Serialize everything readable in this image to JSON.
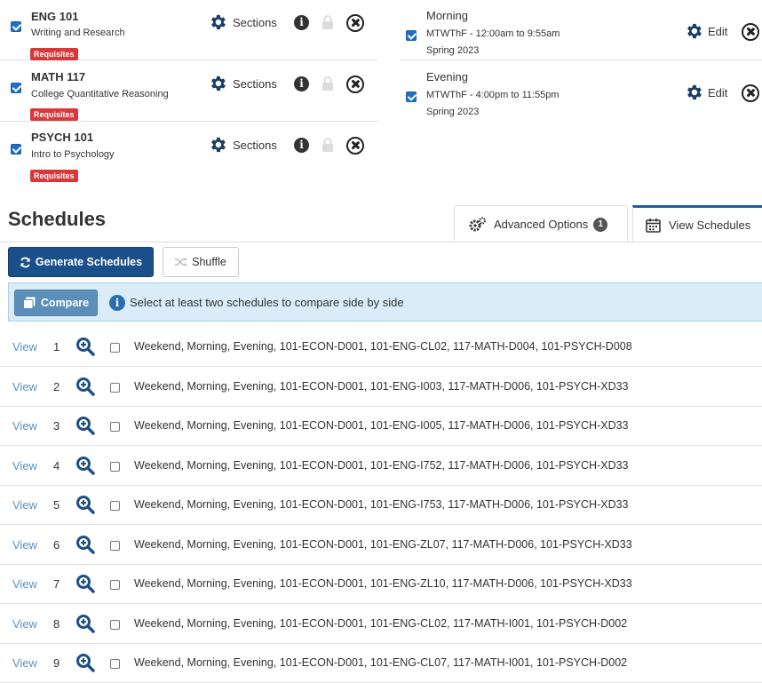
{
  "courses": [
    {
      "code": "ENG 101",
      "title": "Writing and Research",
      "badge": "Requisites",
      "sections_label": "Sections"
    },
    {
      "code": "MATH 117",
      "title": "College Quantitative Reasoning",
      "badge": "Requisites",
      "sections_label": "Sections"
    },
    {
      "code": "PSYCH 101",
      "title": "Intro to Psychology",
      "badge": "Requisites",
      "sections_label": "Sections"
    }
  ],
  "breaks": [
    {
      "name": "Morning",
      "time": "MTWThF - 12:00am to 9:55am",
      "term": "Spring 2023",
      "edit_label": "Edit"
    },
    {
      "name": "Evening",
      "time": "MTWThF - 4:00pm to 11:55pm",
      "term": "Spring 2023",
      "edit_label": "Edit"
    }
  ],
  "schedules": {
    "heading": "Schedules",
    "tabs": {
      "advanced_options": "Advanced Options",
      "advanced_count": "1",
      "view_schedules": "View Schedules"
    },
    "generate_label": "Generate Schedules",
    "shuffle_label": "Shuffle",
    "compare_label": "Compare",
    "compare_hint": "Select at least two schedules to compare side by side",
    "view_label": "View",
    "rows": [
      {
        "num": "1",
        "text": "Weekend, Morning, Evening, 101-ECON-D001, 101-ENG-CL02, 117-MATH-D004, 101-PSYCH-D008"
      },
      {
        "num": "2",
        "text": "Weekend, Morning, Evening, 101-ECON-D001, 101-ENG-I003, 117-MATH-D006, 101-PSYCH-XD33"
      },
      {
        "num": "3",
        "text": "Weekend, Morning, Evening, 101-ECON-D001, 101-ENG-I005, 117-MATH-D006, 101-PSYCH-XD33"
      },
      {
        "num": "4",
        "text": "Weekend, Morning, Evening, 101-ECON-D001, 101-ENG-I752, 117-MATH-D006, 101-PSYCH-XD33"
      },
      {
        "num": "5",
        "text": "Weekend, Morning, Evening, 101-ECON-D001, 101-ENG-I753, 117-MATH-D006, 101-PSYCH-XD33"
      },
      {
        "num": "6",
        "text": "Weekend, Morning, Evening, 101-ECON-D001, 101-ENG-ZL07, 117-MATH-D006, 101-PSYCH-XD33"
      },
      {
        "num": "7",
        "text": "Weekend, Morning, Evening, 101-ECON-D001, 101-ENG-ZL10, 117-MATH-D006, 101-PSYCH-XD33"
      },
      {
        "num": "8",
        "text": "Weekend, Morning, Evening, 101-ECON-D001, 101-ENG-CL02, 117-MATH-I001, 101-PSYCH-D002"
      },
      {
        "num": "9",
        "text": "Weekend, Morning, Evening, 101-ECON-D001, 101-ENG-CL07, 117-MATH-I001, 101-PSYCH-D002"
      }
    ]
  },
  "colors": {
    "primary": "#1b4f8a",
    "link": "#5b8fc4",
    "requisites": "#d9383a",
    "alert_bg": "#d9ecf7"
  },
  "icons": [
    "gear-icon",
    "info-icon",
    "lock-icon",
    "close-circle-icon",
    "refresh-icon",
    "shuffle-icon",
    "copy-icon",
    "cogs-icon",
    "calendar-icon",
    "magnifier-icon"
  ]
}
